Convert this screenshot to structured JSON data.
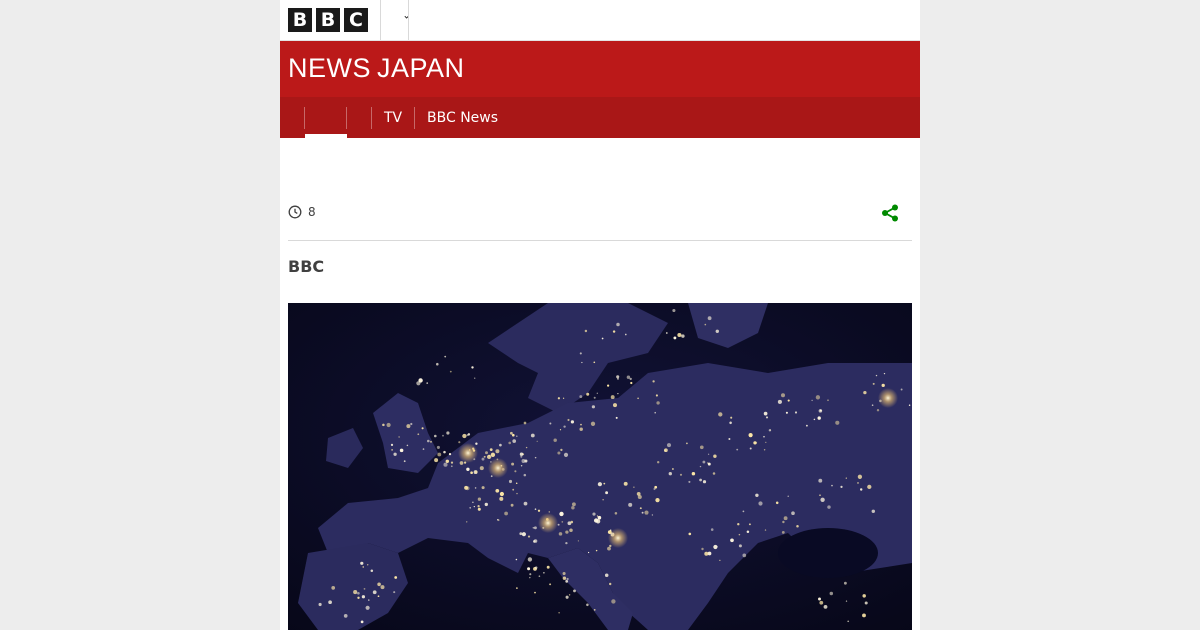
{
  "header": {
    "logo_letters": [
      "B",
      "B",
      "C"
    ]
  },
  "masthead": {
    "brand_news": "NEWS",
    "brand_region": "JAPAN",
    "color": "#bb1919"
  },
  "nav": {
    "items": [
      {
        "label": "TV"
      },
      {
        "label": "BBC News"
      }
    ]
  },
  "article": {
    "reading_time": "8",
    "byline": "BBC",
    "share_icon_color": "#008a00"
  },
  "icons": {
    "more": "chevron-down-icon",
    "clock": "clock-icon",
    "share": "share-icon"
  }
}
